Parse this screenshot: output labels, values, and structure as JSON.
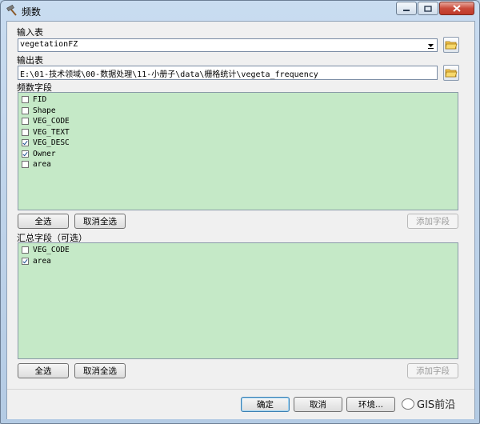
{
  "window": {
    "title": "频数",
    "minimize_icon": "minimize-icon",
    "maximize_icon": "maximize-icon",
    "close_icon": "close-icon"
  },
  "input_table": {
    "label": "输入表",
    "value": "vegetationFZ"
  },
  "output_table": {
    "label": "输出表",
    "value": "E:\\01-技术领域\\00-数据处理\\11-小册子\\data\\栅格统计\\vegeta_frequency"
  },
  "frequency_fields": {
    "label": "频数字段",
    "items": [
      {
        "name": "FID",
        "checked": false
      },
      {
        "name": "Shape",
        "checked": false
      },
      {
        "name": "VEG_CODE",
        "checked": false
      },
      {
        "name": "VEG_TEXT",
        "checked": false
      },
      {
        "name": "VEG_DESC",
        "checked": true
      },
      {
        "name": "Owner",
        "checked": true
      },
      {
        "name": "area",
        "checked": false
      }
    ],
    "select_all": "全选",
    "deselect_all": "取消全选",
    "add_field": "添加字段"
  },
  "summary_fields": {
    "label": "汇总字段（可选）",
    "items": [
      {
        "name": "VEG_CODE",
        "checked": false
      },
      {
        "name": "area",
        "checked": true
      }
    ],
    "select_all": "全选",
    "deselect_all": "取消全选",
    "add_field": "添加字段"
  },
  "footer": {
    "ok": "确定",
    "cancel": "取消",
    "env": "环境...",
    "watermark": "GIS前沿"
  },
  "colors": {
    "list_bg": "#c5e9c7",
    "titlebar": "#c9dcf0",
    "close_button": "#c94a3a"
  }
}
